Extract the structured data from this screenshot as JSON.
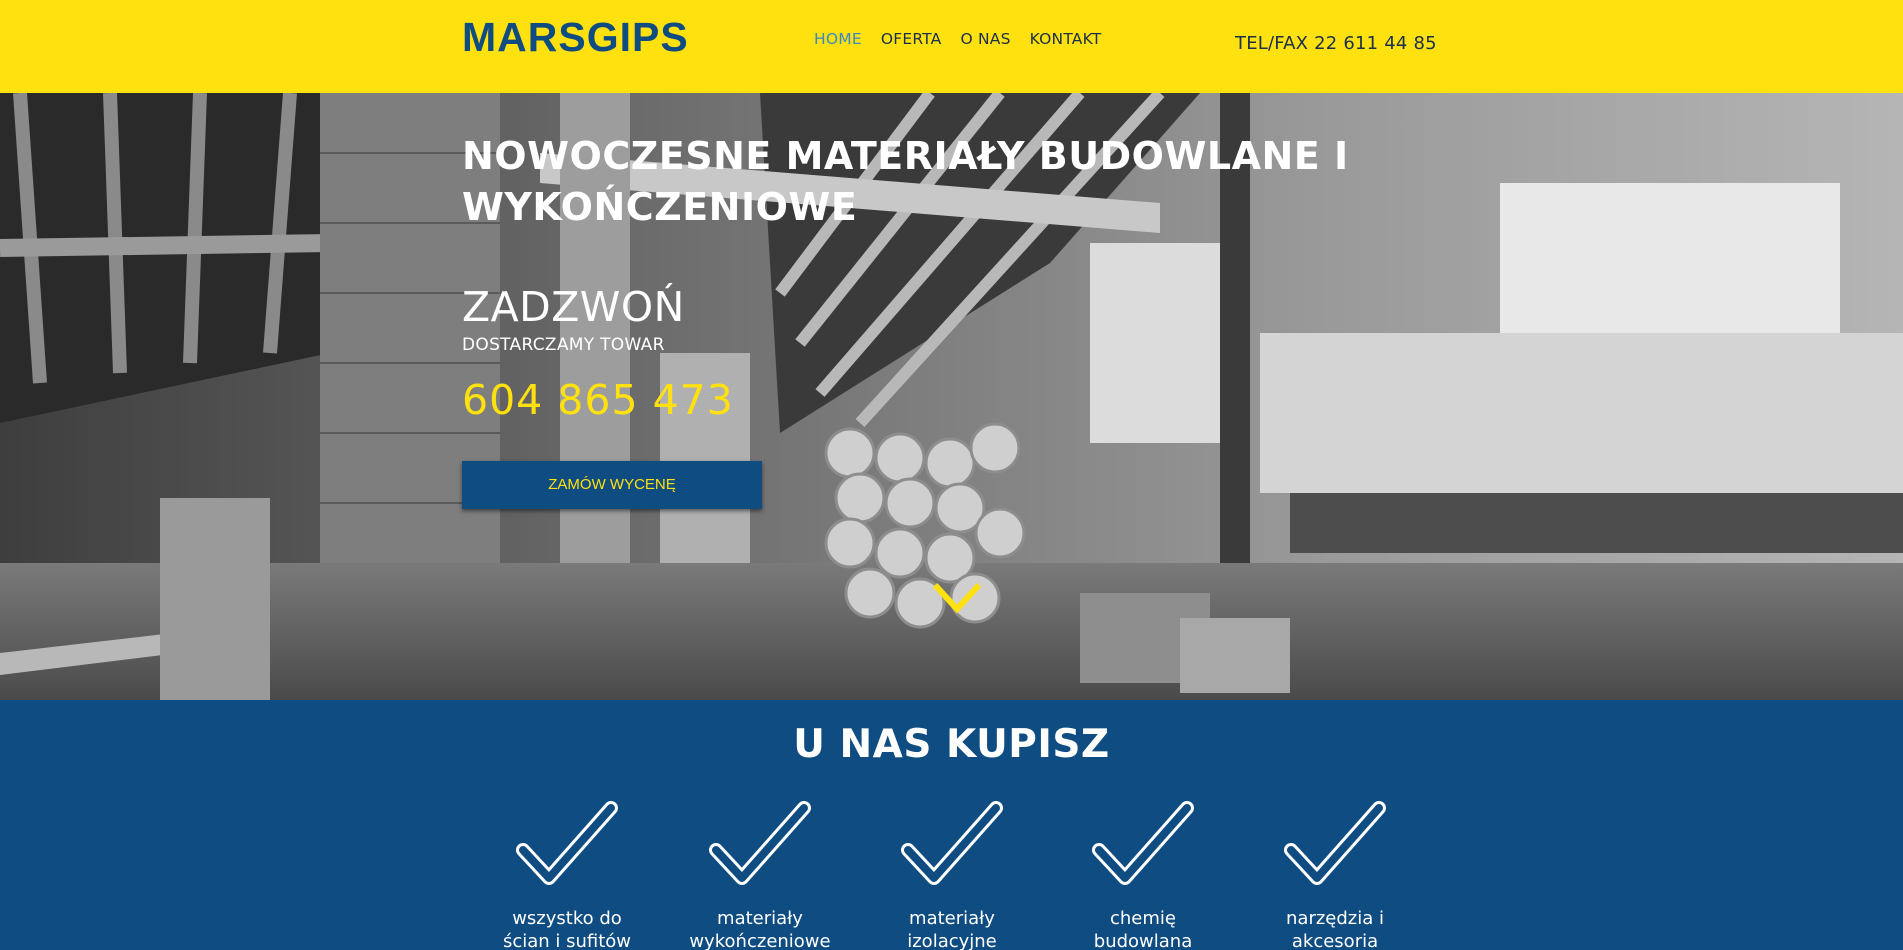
{
  "header": {
    "logo": "MARSGIPS",
    "nav": [
      {
        "label": "HOME",
        "active": true
      },
      {
        "label": "OFERTA",
        "active": false
      },
      {
        "label": "O NAS",
        "active": false
      },
      {
        "label": "KONTAKT",
        "active": false
      }
    ],
    "tel": "TEL/FAX 22 611 44 85"
  },
  "hero": {
    "title": "NOWOCZESNE MATERIAŁY BUDOWLANE I WYKOŃCZENIOWE",
    "call": "ZADZWOŃ",
    "subtitle": "DOSTARCZAMY TOWAR",
    "phone": "604 865 473",
    "button_label": "ZAMÓW WYCENĘ",
    "scroll_icon": "chevron-down-icon"
  },
  "section": {
    "title": "U NAS KUPISZ",
    "items": [
      {
        "icon": "checkmark-icon",
        "label": "wszystko do ścian i sufitów"
      },
      {
        "icon": "checkmark-icon",
        "label": "materiały wykończeniowe"
      },
      {
        "icon": "checkmark-icon",
        "label": "materiały izolacyjne"
      },
      {
        "icon": "checkmark-icon",
        "label": "chemię budowlana"
      },
      {
        "icon": "checkmark-icon",
        "label": "narzędzia i akcesoria"
      }
    ]
  },
  "colors": {
    "header_bg": "#ffe10f",
    "brand_blue": "#0f4c81",
    "accent_yellow": "#ffe10f",
    "nav_active": "#3b87c4"
  }
}
